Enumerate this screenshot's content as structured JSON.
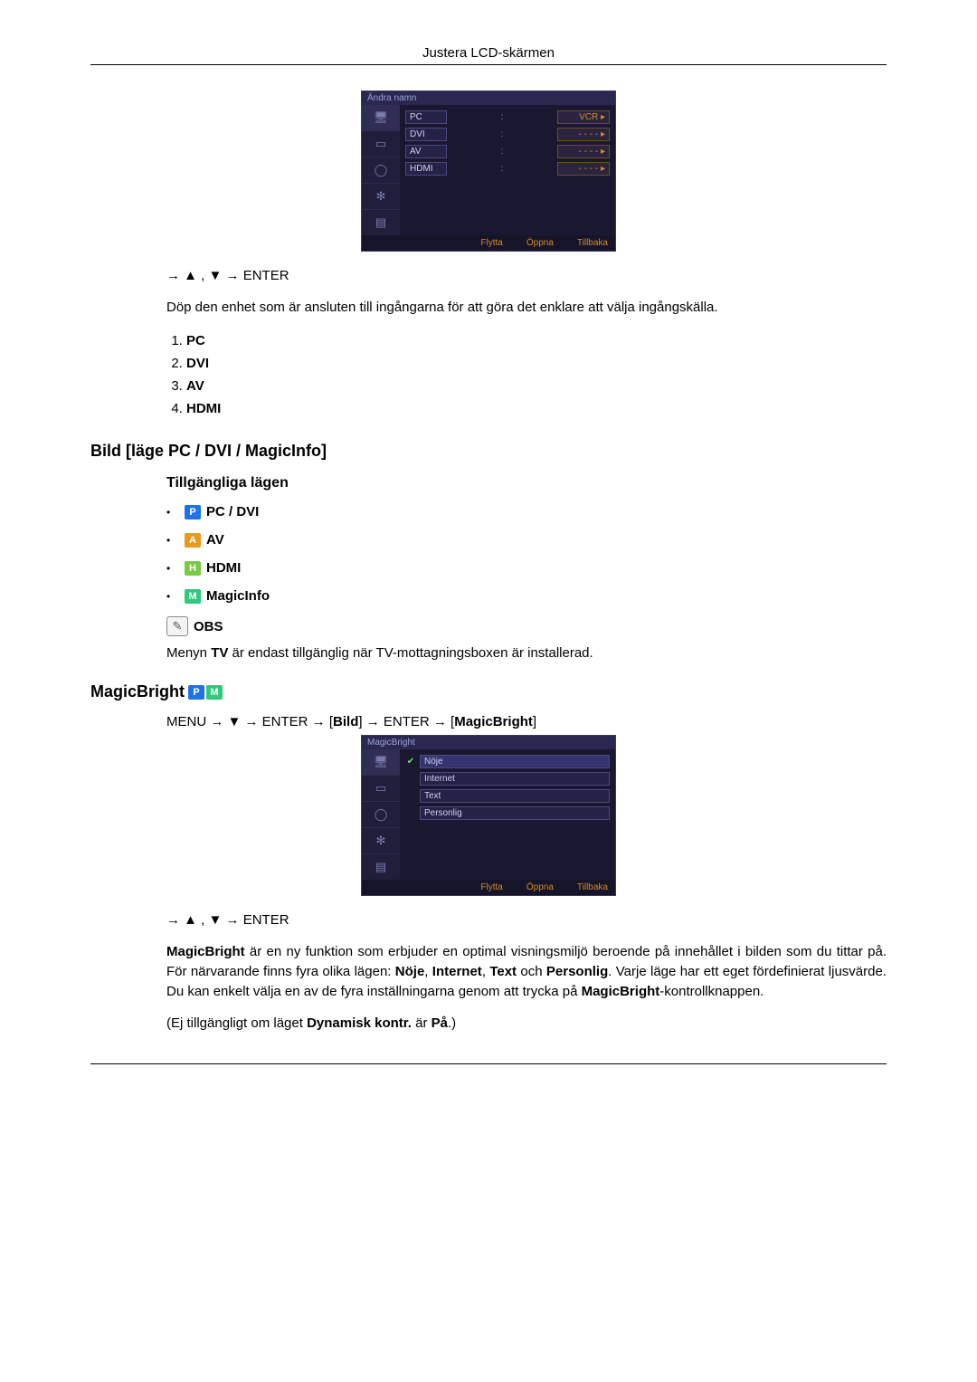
{
  "header": {
    "title": "Justera LCD-skärmen"
  },
  "osd1": {
    "title": "Ändra namn",
    "rows": [
      {
        "label": "PC",
        "value": "VCR ▸"
      },
      {
        "label": "DVI",
        "value": "- - - - ▸"
      },
      {
        "label": "AV",
        "value": "- - - - ▸"
      },
      {
        "label": "HDMI",
        "value": "- - - - ▸"
      }
    ],
    "foot": {
      "move": "Flytta",
      "open": "Öppna",
      "back": "Tillbaka"
    }
  },
  "nav1": {
    "text": "→ ▲ , ▼ → ENTER"
  },
  "desc1": "Döp den enhet som är ansluten till ingångarna för att göra det enklare att välja ingångskälla.",
  "inputs": {
    "i1": "PC",
    "i2": "DVI",
    "i3": "AV",
    "i4": "HDMI"
  },
  "section_bild": "Bild [läge PC / DVI / MagicInfo]",
  "sub_modes": "Tillgängliga lägen",
  "modes": {
    "m1": "PC / DVI",
    "m2": "AV",
    "m3": "HDMI",
    "m4": "MagicInfo"
  },
  "obs_label": "OBS",
  "tv_note_pre": "Menyn ",
  "tv_note_bold": "TV",
  "tv_note_post": " är endast tillgänglig när TV-mottagningsboxen är installerad.",
  "magicbright_heading": "MagicBright",
  "path": {
    "t1": "MENU → ▼ → ENTER → [",
    "b1": "Bild",
    "t2": "] → ENTER → [",
    "b2": "MagicBright",
    "t3": "]"
  },
  "osd2": {
    "title": "MagicBright",
    "opts": [
      {
        "label": "Nöje",
        "checked": true
      },
      {
        "label": "Internet",
        "checked": false
      },
      {
        "label": "Text",
        "checked": false
      },
      {
        "label": "Personlig",
        "checked": false
      }
    ],
    "foot": {
      "move": "Flytta",
      "open": "Öppna",
      "back": "Tillbaka"
    }
  },
  "nav2": {
    "text": "→ ▲ , ▼ → ENTER"
  },
  "mb_desc": {
    "b1": "MagicBright",
    "t1": " är en ny funktion som erbjuder en optimal visningsmiljö beroende på innehållet i bilden som du tittar på. För närvarande finns fyra olika lägen: ",
    "b2": "Nöje",
    "t2": ", ",
    "b3": "Internet",
    "t3": ", ",
    "b4": "Text",
    "t4": " och ",
    "b5": "Personlig",
    "t5": ". Varje läge har ett eget fördefinierat ljusvärde. Du kan enkelt välja en av de fyra inställningarna genom att trycka på ",
    "b6": "MagicBright",
    "t6": "-kontrollknappen."
  },
  "avail": {
    "t1": "(Ej tillgängligt om läget ",
    "b1": "Dynamisk kontr.",
    "t2": " är ",
    "b2": "På",
    "t3": ".)"
  }
}
